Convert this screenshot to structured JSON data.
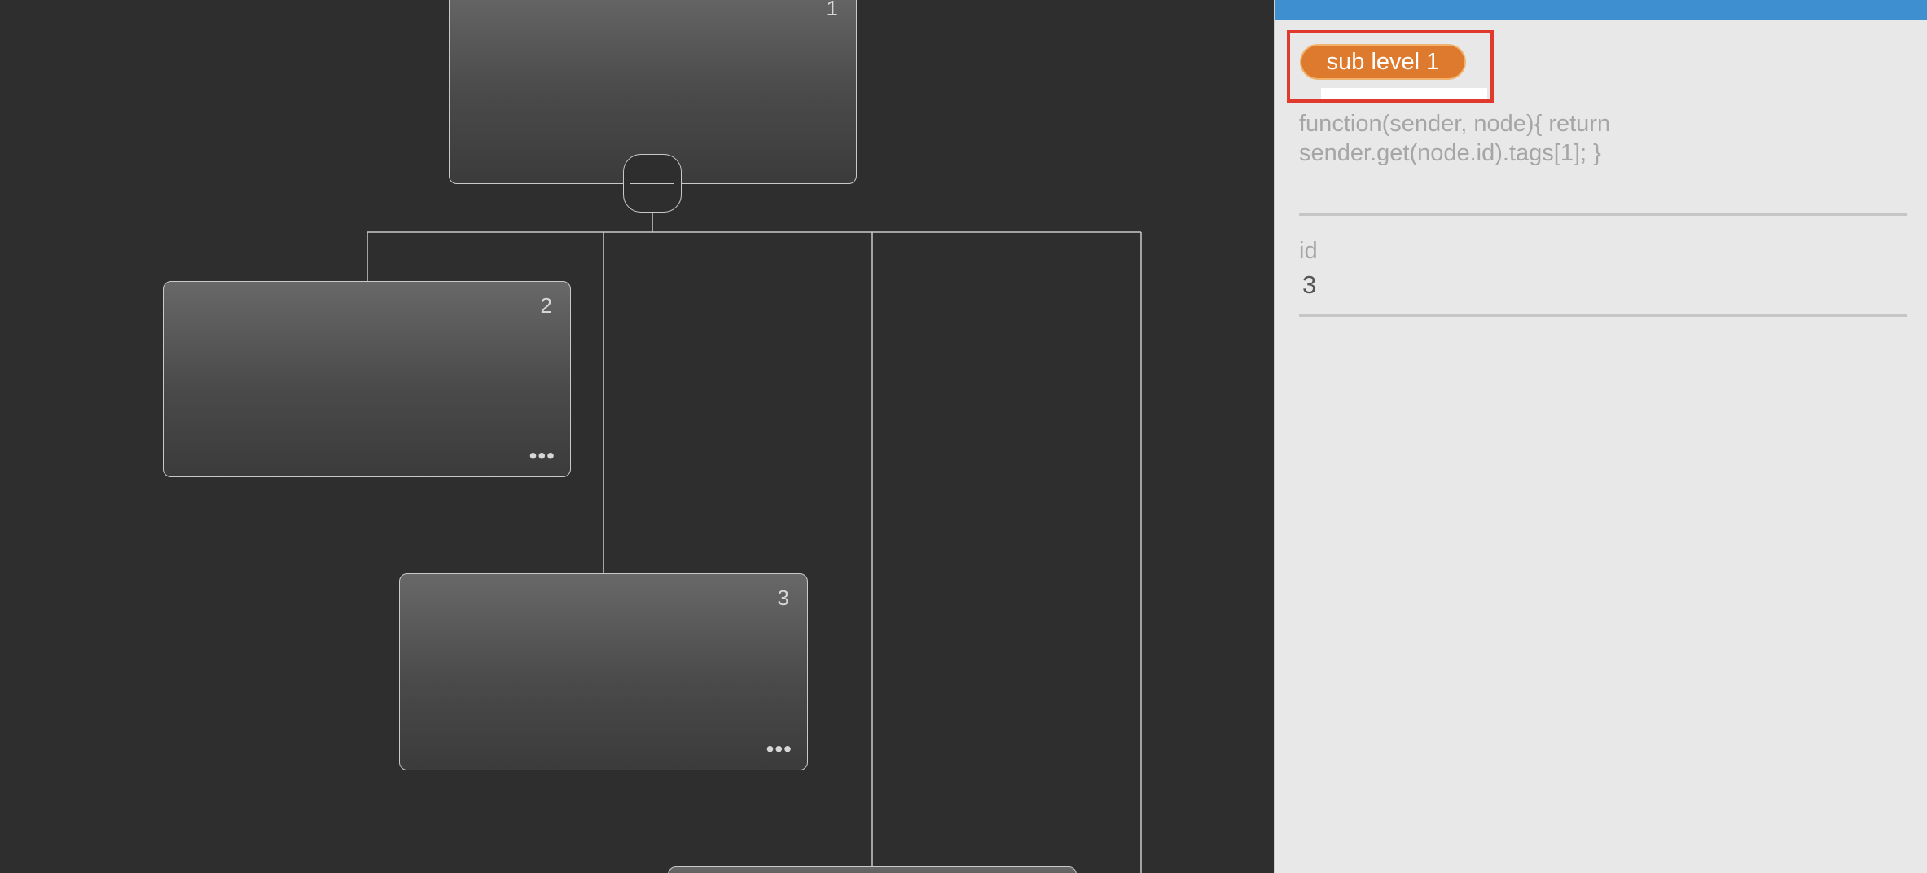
{
  "chart": {
    "nodes": [
      {
        "id": "1",
        "label": "1",
        "has_menu": false
      },
      {
        "id": "2",
        "label": "2",
        "has_menu": true,
        "menu_icon": "ellipsis-icon"
      },
      {
        "id": "3",
        "label": "3",
        "has_menu": true,
        "menu_icon": "ellipsis-icon"
      }
    ],
    "collapse_icon": "minus-icon",
    "colors": {
      "canvas": "#2e2e2e",
      "line": "#c9c9c9",
      "node_top": "#686868",
      "node_bottom": "#3b3b3b"
    }
  },
  "panel": {
    "header_color": "#3e8fd0",
    "tag": {
      "label": "sub level 1",
      "color": "#de7a2e",
      "highlight": "#e03a2f"
    },
    "binding_expression": "function(sender, node){ return sender.get(node.id).tags[1]; }",
    "fields": [
      {
        "label": "id",
        "value": "3"
      }
    ]
  }
}
